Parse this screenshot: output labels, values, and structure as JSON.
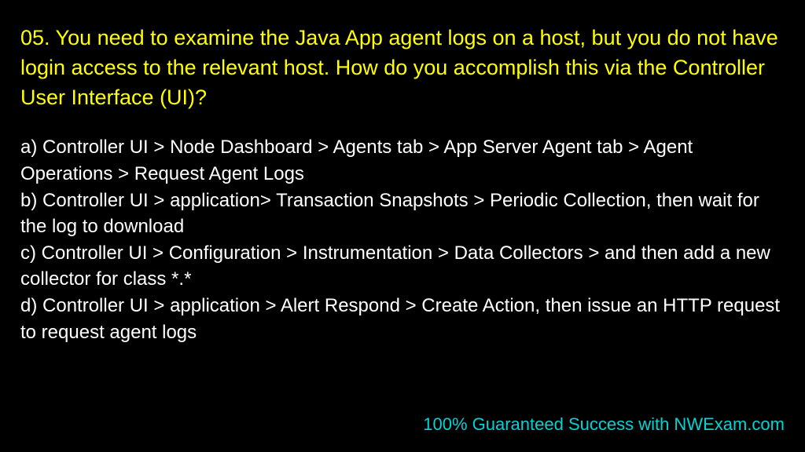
{
  "question": "05. You need to examine the Java App agent logs on a host, but you do not have login access to the relevant host. How do you accomplish this via the Controller User Interface (UI)?",
  "answers": {
    "a": "a) Controller UI > Node Dashboard > Agents tab > App Server Agent tab > Agent Operations > Request Agent Logs",
    "b": "b) Controller UI > application> Transaction Snapshots > Periodic Collection, then wait for the log to download",
    "c": "c) Controller UI > Configuration > Instrumentation > Data Collectors > and then add a new collector for class *.*",
    "d": "d) Controller UI > application > Alert Respond > Create Action, then issue an HTTP request to request agent logs"
  },
  "footer": "100% Guaranteed Success with NWExam.com"
}
